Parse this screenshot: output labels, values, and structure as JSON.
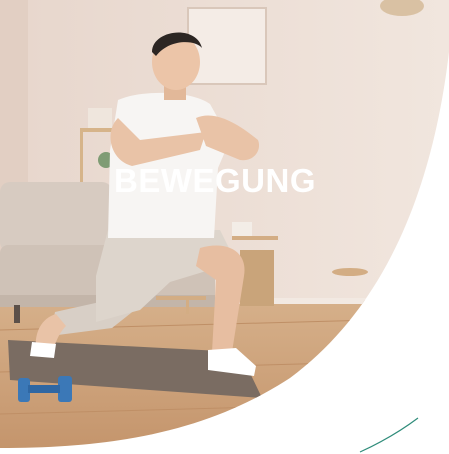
{
  "banner": {
    "title": "BEWEGUNG",
    "title_color": "#ffffff",
    "photo_subject": "man-doing-lunge-at-home",
    "colors": {
      "wall": "#eadbd2",
      "floor": "#c79a6f",
      "mat": "#7a6c62",
      "dumbbell": "#3b78b7",
      "accent_line": "#2f8c7a"
    }
  }
}
